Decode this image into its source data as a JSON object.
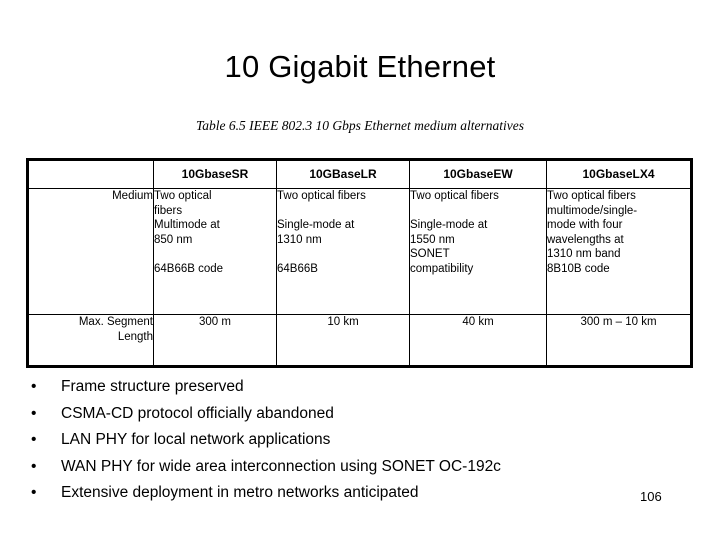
{
  "slide": {
    "title": "10 Gigabit Ethernet",
    "page_number": "106"
  },
  "table": {
    "caption": "Table 6.5  IEEE 802.3 10 Gbps Ethernet medium alternatives",
    "headers": {
      "corner": "",
      "sr": "10GbaseSR",
      "lr": "10GBaseLR",
      "ew": "10GbaseEW",
      "lx4": "10GbaseLX4"
    },
    "rows": {
      "medium": {
        "label": "Medium",
        "sr": {
          "l1": "Two optical",
          "l2": "fibers",
          "l3": "Multimode at",
          "l4": "850 nm",
          "l5": "64B66B code"
        },
        "lr": {
          "l1": "Two optical fibers",
          "l2": "Single-mode at",
          "l3": "1310 nm",
          "l4": "64B66B"
        },
        "ew": {
          "l1": "Two optical fibers",
          "l2": "Single-mode at",
          "l3": "1550 nm",
          "l4": "SONET",
          "l5": "compatibility"
        },
        "lx4": {
          "l1": "Two optical fibers",
          "l2": "multimode/single-",
          "l3": "mode with four",
          "l4": "wavelengths at",
          "l5": "1310 nm band",
          "l6": "8B10B code"
        }
      },
      "max_segment_length": {
        "label_l1": "Max. Segment",
        "label_l2": "Length",
        "sr": "300 m",
        "lr": "10 km",
        "ew": "40 km",
        "lx4": "300 m – 10 km"
      }
    }
  },
  "bullets": [
    {
      "marker": "•",
      "text": "Frame structure preserved"
    },
    {
      "marker": "•",
      "text": "CSMA-CD protocol officially abandoned"
    },
    {
      "marker": "•",
      "text": "LAN PHY for local network applications"
    },
    {
      "marker": "•",
      "text": "WAN PHY for wide area interconnection using SONET OC-192c"
    },
    {
      "marker": "•",
      "text": "Extensive deployment in metro networks anticipated"
    }
  ]
}
